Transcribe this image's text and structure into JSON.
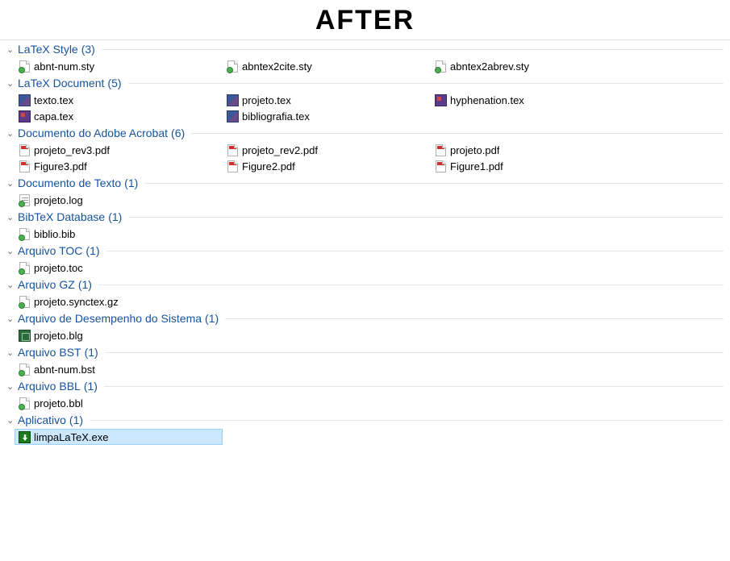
{
  "title": "AFTER",
  "groups": [
    {
      "label": "LaTeX Style",
      "count": "(3)",
      "files": [
        {
          "name": "abnt-num.sty",
          "icon": "sty",
          "selected": false
        },
        {
          "name": "abntex2cite.sty",
          "icon": "sty",
          "selected": false
        },
        {
          "name": "abntex2abrev.sty",
          "icon": "sty",
          "selected": false
        }
      ]
    },
    {
      "label": "LaTeX Document",
      "count": "(5)",
      "files": [
        {
          "name": "texto.tex",
          "icon": "tex",
          "selected": false
        },
        {
          "name": "projeto.tex",
          "icon": "tex",
          "selected": false
        },
        {
          "name": "hyphenation.tex",
          "icon": "tex-alt",
          "selected": false
        },
        {
          "name": "capa.tex",
          "icon": "tex-alt",
          "selected": false
        },
        {
          "name": "bibliografia.tex",
          "icon": "tex",
          "selected": false
        }
      ]
    },
    {
      "label": "Documento do Adobe Acrobat",
      "count": "(6)",
      "files": [
        {
          "name": "projeto_rev3.pdf",
          "icon": "pdf",
          "selected": false
        },
        {
          "name": "projeto_rev2.pdf",
          "icon": "pdf",
          "selected": false
        },
        {
          "name": "projeto.pdf",
          "icon": "pdf",
          "selected": false
        },
        {
          "name": "Figure3.pdf",
          "icon": "pdf",
          "selected": false
        },
        {
          "name": "Figure2.pdf",
          "icon": "pdf",
          "selected": false
        },
        {
          "name": "Figure1.pdf",
          "icon": "pdf",
          "selected": false
        }
      ]
    },
    {
      "label": "Documento de Texto",
      "count": "(1)",
      "files": [
        {
          "name": "projeto.log",
          "icon": "txt",
          "selected": false
        }
      ]
    },
    {
      "label": "BibTeX Database",
      "count": "(1)",
      "files": [
        {
          "name": "biblio.bib",
          "icon": "sty",
          "selected": false
        }
      ]
    },
    {
      "label": "Arquivo TOC",
      "count": "(1)",
      "files": [
        {
          "name": "projeto.toc",
          "icon": "page",
          "selected": false
        }
      ]
    },
    {
      "label": "Arquivo GZ",
      "count": "(1)",
      "files": [
        {
          "name": "projeto.synctex.gz",
          "icon": "page",
          "selected": false
        }
      ]
    },
    {
      "label": "Arquivo de Desempenho do Sistema",
      "count": "(1)",
      "files": [
        {
          "name": "projeto.blg",
          "icon": "blg",
          "selected": false
        }
      ]
    },
    {
      "label": "Arquivo BST",
      "count": "(1)",
      "files": [
        {
          "name": "abnt-num.bst",
          "icon": "page",
          "selected": false
        }
      ]
    },
    {
      "label": "Arquivo BBL",
      "count": "(1)",
      "files": [
        {
          "name": "projeto.bbl",
          "icon": "page",
          "selected": false
        }
      ]
    },
    {
      "label": "Aplicativo",
      "count": "(1)",
      "files": [
        {
          "name": "limpaLaTeX.exe",
          "icon": "exe",
          "selected": true
        }
      ]
    }
  ]
}
